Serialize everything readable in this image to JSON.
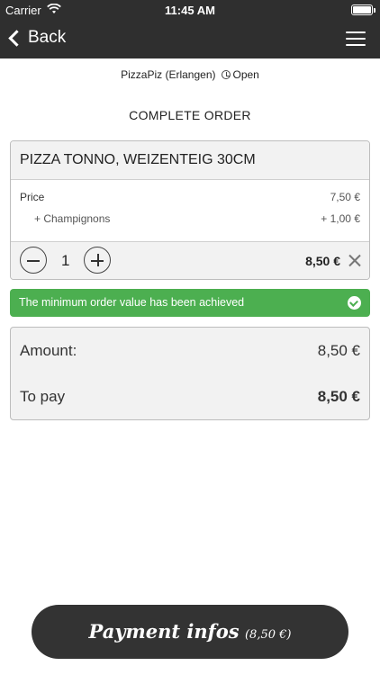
{
  "status_bar": {
    "carrier": "Carrier",
    "time": "11:45 AM"
  },
  "nav": {
    "back_label": "Back"
  },
  "shop": {
    "name": "PizzaPiz (Erlangen)",
    "status": "Open"
  },
  "page_title": "COMPLETE ORDER",
  "order_item": {
    "name": "PIZZA TONNO, WEIZENTEIG 30CM",
    "price_label": "Price",
    "price_value": "7,50 €",
    "extras": [
      {
        "name": "+ Champignons",
        "value": "+ 1,00 €"
      }
    ],
    "quantity": "1",
    "line_total": "8,50 €"
  },
  "notice": {
    "text": "The minimum order value has been achieved"
  },
  "summary": {
    "amount_label": "Amount:",
    "amount_value": "8,50 €",
    "to_pay_label": "To pay",
    "to_pay_value": "8,50 €"
  },
  "payment_button": {
    "label": "Payment infos",
    "amount": "(8,50 €)"
  },
  "colors": {
    "bar": "#2f2f2f",
    "notice_green": "#4caf50",
    "button": "#333333"
  }
}
